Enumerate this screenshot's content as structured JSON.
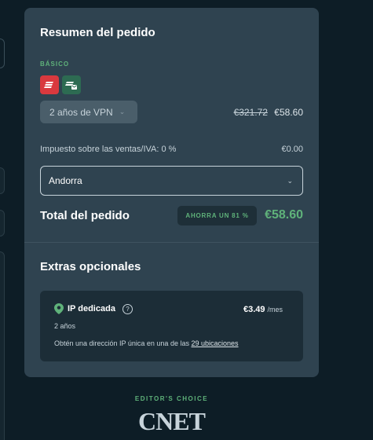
{
  "summary": {
    "title": "Resumen del pedido",
    "plan_label": "BÁSICO",
    "logos": [
      "expressvpn-logo",
      "expressmailguard-logo"
    ],
    "plan_select": "2 años de VPN",
    "price_original": "€321.72",
    "price_current": "€58.60",
    "tax_label": "Impuesto sobre las ventas/IVA: 0 %",
    "tax_value": "€0.00",
    "country": "Andorra",
    "total_label": "Total del pedido",
    "save_badge": "AHORRA UN 81 %",
    "total_value": "€58.60"
  },
  "extras": {
    "title": "Extras opcionales",
    "item": {
      "name": "IP dedicada",
      "price": "€3.49",
      "per": "/mes",
      "years": "2 años",
      "desc_prefix": "Obtén una dirección IP única en una de las ",
      "desc_link": "29 ubicaciones"
    }
  },
  "footer": {
    "editor": "EDITOR'S CHOICE",
    "brand": "CNET"
  },
  "colors": {
    "accent_green": "#5fb27a",
    "card_bg": "#2f4350",
    "page_bg": "#0d1d26",
    "logo_red": "#d9393e"
  }
}
